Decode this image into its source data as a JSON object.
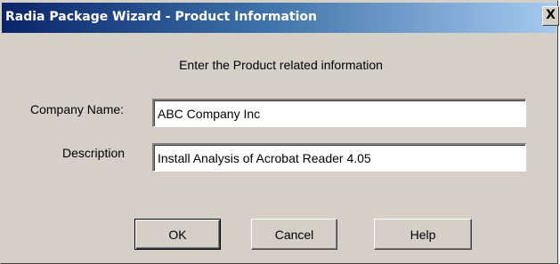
{
  "window": {
    "title": "Radia Package Wizard - Product Information",
    "close_glyph": "X"
  },
  "heading": "Enter the Product related information",
  "fields": {
    "company_name": {
      "label": "Company Name:",
      "value": "ABC Company Inc"
    },
    "description": {
      "label": "Description",
      "value": "Install Analysis of Acrobat Reader 4.05"
    }
  },
  "buttons": {
    "ok": "OK",
    "cancel": "Cancel",
    "help": "Help"
  }
}
